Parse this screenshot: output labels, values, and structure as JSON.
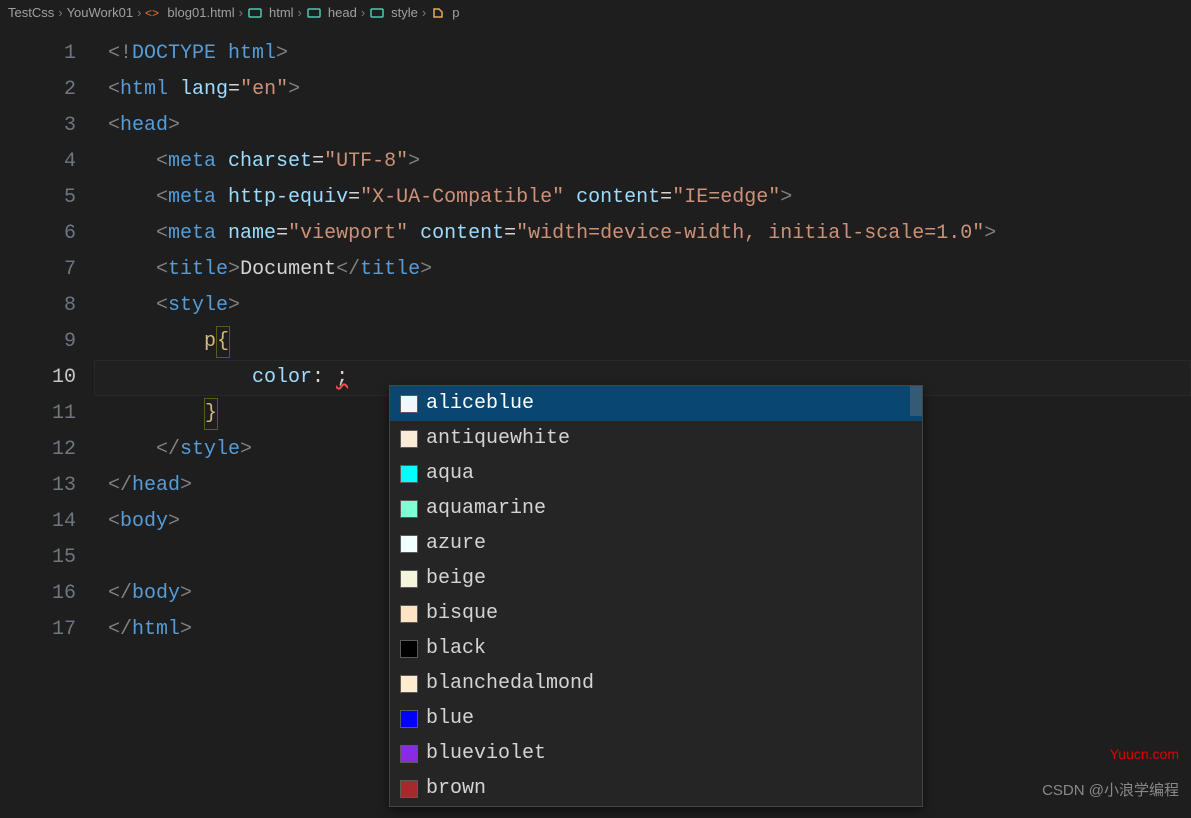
{
  "breadcrumb": {
    "items": [
      {
        "label": "TestCss",
        "icon": null
      },
      {
        "label": "YouWork01",
        "icon": null
      },
      {
        "label": "blog01.html",
        "icon": "file-html-icon"
      },
      {
        "label": "html",
        "icon": "struct-icon"
      },
      {
        "label": "head",
        "icon": "struct-icon"
      },
      {
        "label": "style",
        "icon": "struct-icon"
      },
      {
        "label": "p",
        "icon": "class-icon"
      }
    ],
    "separator": "›"
  },
  "editor": {
    "current_line": 10,
    "lines": [
      {
        "num": 1,
        "tokens": [
          [
            "<!",
            "punc"
          ],
          [
            "DOCTYPE html",
            "doctype"
          ],
          [
            ">",
            "punc"
          ]
        ]
      },
      {
        "num": 2,
        "tokens": [
          [
            "<",
            "punc"
          ],
          [
            "html ",
            "tag"
          ],
          [
            "lang",
            "attr"
          ],
          [
            "=",
            "white"
          ],
          [
            "\"en\"",
            "str"
          ],
          [
            ">",
            "punc"
          ]
        ]
      },
      {
        "num": 3,
        "tokens": [
          [
            "<",
            "punc"
          ],
          [
            "head",
            "tag"
          ],
          [
            ">",
            "punc"
          ]
        ]
      },
      {
        "num": 4,
        "tokens": [
          [
            "    ",
            "white"
          ],
          [
            "<",
            "punc"
          ],
          [
            "meta ",
            "tag"
          ],
          [
            "charset",
            "attr"
          ],
          [
            "=",
            "white"
          ],
          [
            "\"UTF-8\"",
            "str"
          ],
          [
            ">",
            "punc"
          ]
        ]
      },
      {
        "num": 5,
        "tokens": [
          [
            "    ",
            "white"
          ],
          [
            "<",
            "punc"
          ],
          [
            "meta ",
            "tag"
          ],
          [
            "http-equiv",
            "attr"
          ],
          [
            "=",
            "white"
          ],
          [
            "\"X-UA-Compatible\"",
            "str"
          ],
          [
            " ",
            "white"
          ],
          [
            "content",
            "attr"
          ],
          [
            "=",
            "white"
          ],
          [
            "\"IE=edge\"",
            "str"
          ],
          [
            ">",
            "punc"
          ]
        ]
      },
      {
        "num": 6,
        "tokens": [
          [
            "    ",
            "white"
          ],
          [
            "<",
            "punc"
          ],
          [
            "meta ",
            "tag"
          ],
          [
            "name",
            "attr"
          ],
          [
            "=",
            "white"
          ],
          [
            "\"viewport\"",
            "str"
          ],
          [
            " ",
            "white"
          ],
          [
            "content",
            "attr"
          ],
          [
            "=",
            "white"
          ],
          [
            "\"width=device-width, initial-scale=1.0\"",
            "str"
          ],
          [
            ">",
            "punc"
          ]
        ]
      },
      {
        "num": 7,
        "tokens": [
          [
            "    ",
            "white"
          ],
          [
            "<",
            "punc"
          ],
          [
            "title",
            "tag"
          ],
          [
            ">",
            "punc"
          ],
          [
            "Document",
            "white"
          ],
          [
            "</",
            "punc"
          ],
          [
            "title",
            "tag"
          ],
          [
            ">",
            "punc"
          ]
        ]
      },
      {
        "num": 8,
        "tokens": [
          [
            "    ",
            "white"
          ],
          [
            "<",
            "punc"
          ],
          [
            "style",
            "tag"
          ],
          [
            ">",
            "punc"
          ]
        ]
      },
      {
        "num": 9,
        "tokens": [
          [
            "        ",
            "white"
          ],
          [
            "p",
            "sel"
          ],
          [
            "{",
            "brace-open"
          ]
        ]
      },
      {
        "num": 10,
        "tokens": [
          [
            "            ",
            "white"
          ],
          [
            "color",
            "prop"
          ],
          [
            ": ",
            "white"
          ],
          [
            ";",
            "err"
          ]
        ]
      },
      {
        "num": 11,
        "tokens": [
          [
            "        ",
            "white"
          ],
          [
            "}",
            "brace-close"
          ]
        ]
      },
      {
        "num": 12,
        "tokens": [
          [
            "    ",
            "white"
          ],
          [
            "</",
            "punc"
          ],
          [
            "style",
            "tag"
          ],
          [
            ">",
            "punc"
          ]
        ]
      },
      {
        "num": 13,
        "tokens": [
          [
            "</",
            "punc"
          ],
          [
            "head",
            "tag"
          ],
          [
            ">",
            "punc"
          ]
        ]
      },
      {
        "num": 14,
        "tokens": [
          [
            "<",
            "punc"
          ],
          [
            "body",
            "tag"
          ],
          [
            ">",
            "punc"
          ]
        ]
      },
      {
        "num": 15,
        "tokens": []
      },
      {
        "num": 16,
        "tokens": [
          [
            "</",
            "punc"
          ],
          [
            "body",
            "tag"
          ],
          [
            ">",
            "punc"
          ]
        ]
      },
      {
        "num": 17,
        "tokens": [
          [
            "</",
            "punc"
          ],
          [
            "html",
            "tag"
          ],
          [
            ">",
            "punc"
          ]
        ]
      }
    ]
  },
  "autocomplete": {
    "selected_index": 0,
    "items": [
      {
        "label": "aliceblue",
        "color": "#f0f8ff"
      },
      {
        "label": "antiquewhite",
        "color": "#faebd7"
      },
      {
        "label": "aqua",
        "color": "#00ffff"
      },
      {
        "label": "aquamarine",
        "color": "#7fffd4"
      },
      {
        "label": "azure",
        "color": "#f0ffff"
      },
      {
        "label": "beige",
        "color": "#f5f5dc"
      },
      {
        "label": "bisque",
        "color": "#ffe4c4"
      },
      {
        "label": "black",
        "color": "#000000"
      },
      {
        "label": "blanchedalmond",
        "color": "#ffebcd"
      },
      {
        "label": "blue",
        "color": "#0000ff"
      },
      {
        "label": "blueviolet",
        "color": "#8a2be2"
      },
      {
        "label": "brown",
        "color": "#a52a2a"
      }
    ]
  },
  "watermarks": {
    "top": "Yuucn.com",
    "bottom": "CSDN @小浪学编程"
  }
}
